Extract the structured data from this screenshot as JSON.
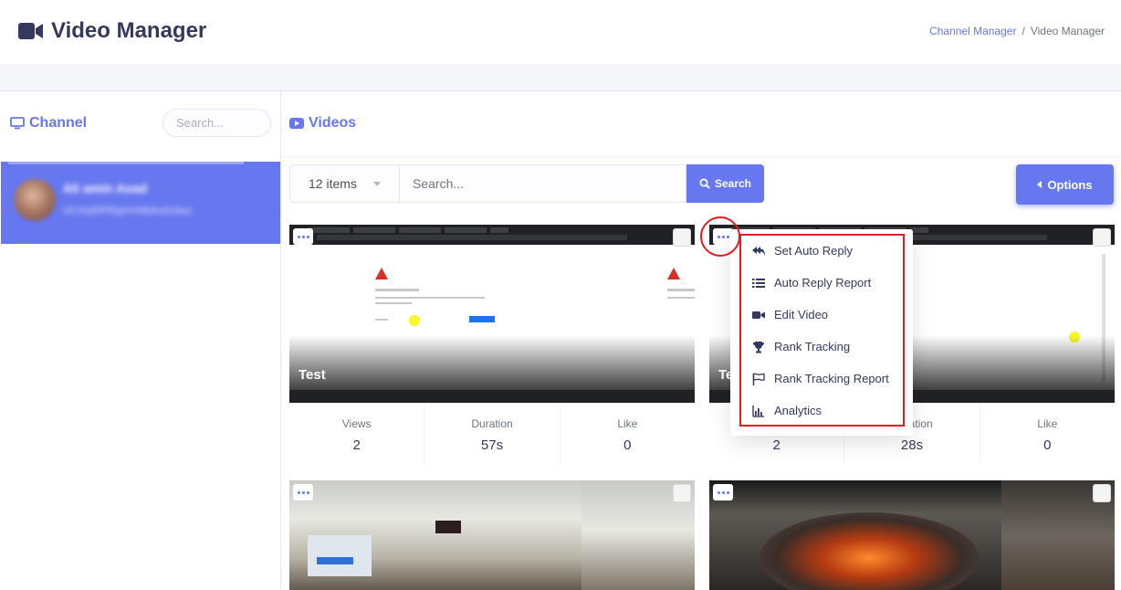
{
  "header": {
    "title": "Video Manager",
    "breadcrumb": [
      "Channel Manager",
      "Video Manager"
    ]
  },
  "channel_panel": {
    "title": "Channel",
    "search_placeholder": "Search...",
    "item": {
      "name": "Ali amin Asad",
      "id": "UCXIyEfFfGpHVMlzkuDzbsz"
    }
  },
  "videos_panel": {
    "title": "Videos",
    "items_select": "12 items",
    "search_placeholder": "Search...",
    "search_button": "Search",
    "options_button": "Options",
    "stat_labels": {
      "views": "Views",
      "duration": "Duration",
      "like": "Like"
    },
    "videos": [
      {
        "title": "Test",
        "views": "2",
        "duration": "57s",
        "like": "0"
      },
      {
        "title": "Te",
        "views": "2",
        "duration": "28s",
        "like": "0"
      },
      {
        "title": ""
      },
      {
        "title": ""
      }
    ]
  },
  "dropdown": {
    "items": [
      {
        "label": "Set Auto Reply",
        "icon": "reply-all-icon"
      },
      {
        "label": "Auto Reply Report",
        "icon": "list-icon"
      },
      {
        "label": "Edit Video",
        "icon": "video-camera-icon"
      },
      {
        "label": "Rank Tracking",
        "icon": "trophy-icon"
      },
      {
        "label": "Rank Tracking Report",
        "icon": "flag-icon"
      },
      {
        "label": "Analytics",
        "icon": "chart-bar-icon"
      }
    ]
  },
  "colors": {
    "primary": "#6777ef",
    "text": "#34395e",
    "annotation": "#e21b24",
    "page_bg": "#f4f6f9"
  }
}
